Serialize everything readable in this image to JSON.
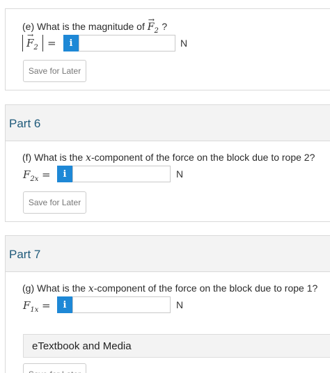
{
  "part_e": {
    "question_prefix": "(e) What is the magnitude of",
    "question_var": "F",
    "question_sub": "2",
    "question_suffix": "?",
    "var": "F",
    "sub": "2",
    "equals": "=",
    "info": "i",
    "value": "",
    "unit": "N",
    "save_label": "Save for Later"
  },
  "part_6": {
    "title": "Part 6",
    "question_prefix": "(f) What is the",
    "question_var": "x",
    "question_suffix": "-component of the force on the block due to rope 2?",
    "var": "F",
    "sub": "2x",
    "equals": "=",
    "info": "i",
    "value": "",
    "unit": "N",
    "save_label": "Save for Later"
  },
  "part_7": {
    "title": "Part 7",
    "question_prefix": "(g) What is the",
    "question_var": "x",
    "question_suffix": "-component of the force on the block due to rope 1?",
    "var": "F",
    "sub": "1x",
    "equals": "=",
    "info": "i",
    "value": "",
    "unit": "N",
    "etextbook_label": "eTextbook and Media",
    "save_label": "Save for Later"
  },
  "colors": {
    "info_button": "#1e88d6",
    "part_title": "#1f5a7a",
    "header_bg": "#f3f3f3"
  }
}
